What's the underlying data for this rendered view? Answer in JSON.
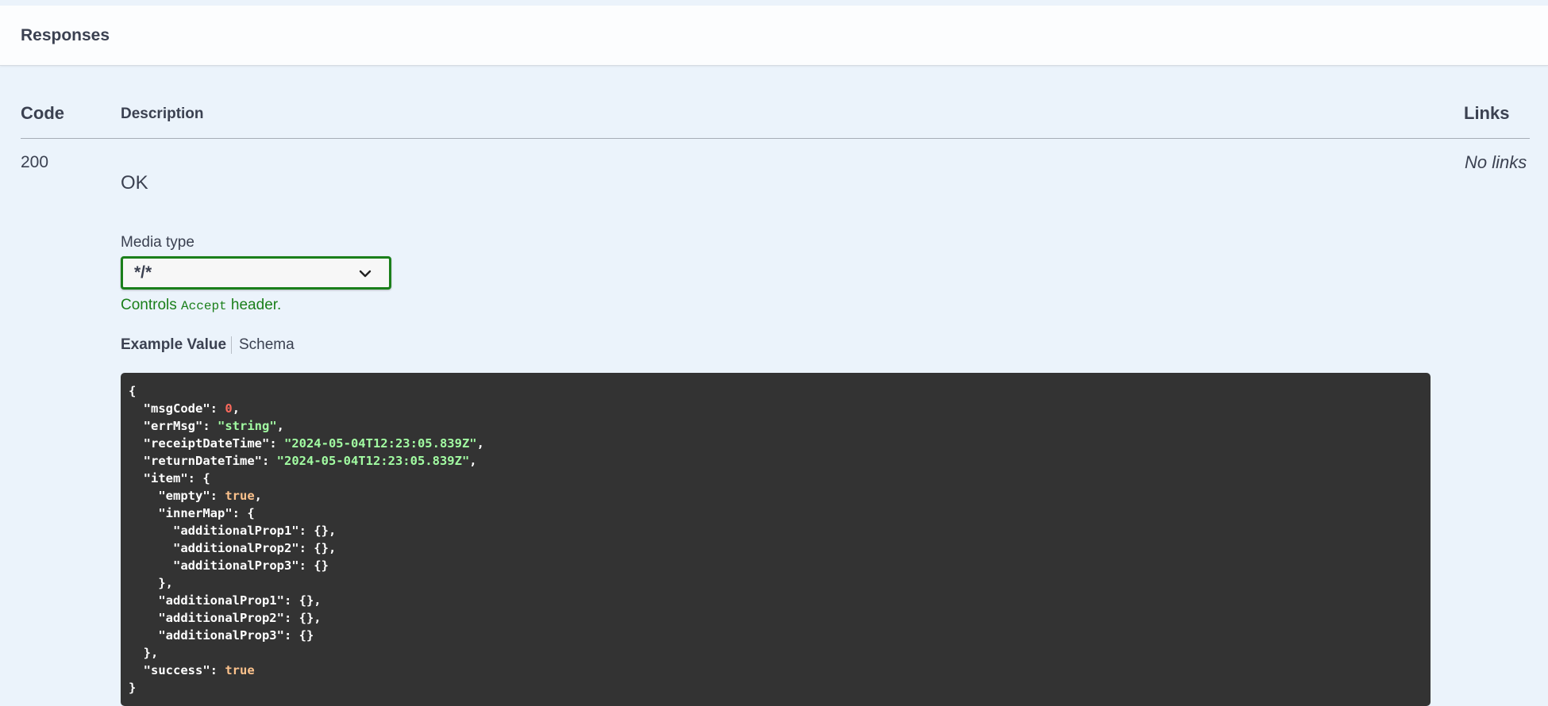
{
  "responses": {
    "title": "Responses"
  },
  "table": {
    "headers": {
      "code": "Code",
      "description": "Description",
      "links": "Links"
    },
    "rows": [
      {
        "code": "200",
        "description": "OK",
        "links": "No links",
        "media_type_label": "Media type",
        "media_type_value": "*/*",
        "controls_prefix": "Controls",
        "controls_code": "Accept",
        "controls_suffix": "header.",
        "tabs": {
          "example_value": "Example Value",
          "schema": "Schema"
        },
        "example": {
          "keys": {
            "msgCode": "\"msgCode\"",
            "errMsg": "\"errMsg\"",
            "receiptDateTime": "\"receiptDateTime\"",
            "returnDateTime": "\"returnDateTime\"",
            "item": "\"item\"",
            "empty": "\"empty\"",
            "innerMap": "\"innerMap\"",
            "additionalProp1": "\"additionalProp1\"",
            "additionalProp2": "\"additionalProp2\"",
            "additionalProp3": "\"additionalProp3\"",
            "success": "\"success\""
          },
          "values": {
            "msgCode": "0",
            "errMsg": "\"string\"",
            "receiptDateTime": "\"2024-05-04T12:23:05.839Z\"",
            "returnDateTime": "\"2024-05-04T12:23:05.839Z\"",
            "empty": "true",
            "success": "true"
          }
        }
      }
    ]
  },
  "colors": {
    "accent_green": "#1a7f1a",
    "code_bg": "#333333",
    "json_number": "#fc6a5d",
    "json_string": "#a2fca2",
    "json_boolean": "#fcc28c"
  },
  "icons": {
    "select_chevron": "chevron-down-icon"
  }
}
